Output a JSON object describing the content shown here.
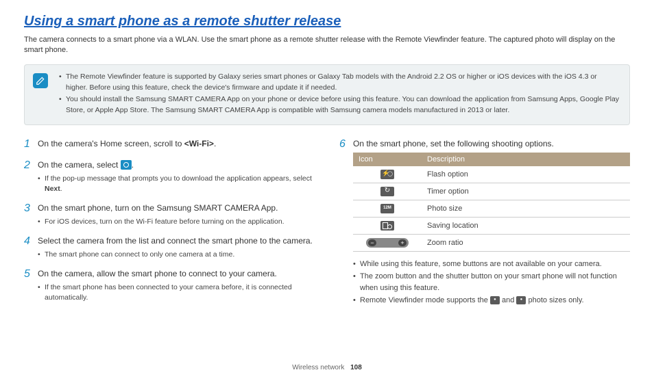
{
  "title": "Using a smart phone as a remote shutter release",
  "intro": "The camera connects to a smart phone via a WLAN. Use the smart phone as a remote shutter release with the Remote Viewfinder feature. The captured photo will display on the smart phone.",
  "notes": [
    "The Remote Viewfinder feature is supported by Galaxy series smart phones or Galaxy Tab models with the Android 2.2 OS or higher or iOS devices with the iOS 4.3 or higher. Before using this feature, check the device's firmware and update it if needed.",
    "You should install the Samsung SMART CAMERA App on your phone or device before using this feature. You can download the application from Samsung Apps, Google Play Store, or Apple App Store. The Samsung SMART CAMERA App is compatible with Samsung camera models manufactured in 2013 or later."
  ],
  "steps": {
    "s1": {
      "num": "1",
      "text_a": "On the camera's Home screen, scroll to ",
      "bold": "<Wi-Fi>",
      "text_b": "."
    },
    "s2": {
      "num": "2",
      "text_a": "On the camera, select ",
      "text_b": ".",
      "sub_a": "If the pop-up message that prompts you to download the application appears, select ",
      "sub_bold": "Next",
      "sub_b": "."
    },
    "s3": {
      "num": "3",
      "text": "On the smart phone, turn on the Samsung SMART CAMERA App.",
      "sub": "For iOS devices, turn on the Wi-Fi feature before turning on the application."
    },
    "s4": {
      "num": "4",
      "text": "Select the camera from the list and connect the smart phone to the camera.",
      "sub": "The smart phone can connect to only one camera at a time."
    },
    "s5": {
      "num": "5",
      "text": "On the camera, allow the smart phone to connect to your camera.",
      "sub": "If the smart phone has been connected to your camera before, it is connected automatically."
    },
    "s6": {
      "num": "6",
      "text": "On the smart phone, set the following shooting options."
    }
  },
  "table": {
    "h1": "Icon",
    "h2": "Description",
    "r1": "Flash option",
    "r2": "Timer option",
    "r3": "Photo size",
    "r4": "Saving location",
    "r5": "Zoom ratio"
  },
  "after": {
    "a1": "While using this feature, some buttons are not available on your camera.",
    "a2": "The zoom button and the shutter button on your smart phone will not function when using this feature.",
    "a3_a": "Remote Viewfinder mode supports the ",
    "a3_b": " and ",
    "a3_c": " photo sizes only."
  },
  "footer": {
    "section": "Wireless network",
    "page": "108"
  }
}
